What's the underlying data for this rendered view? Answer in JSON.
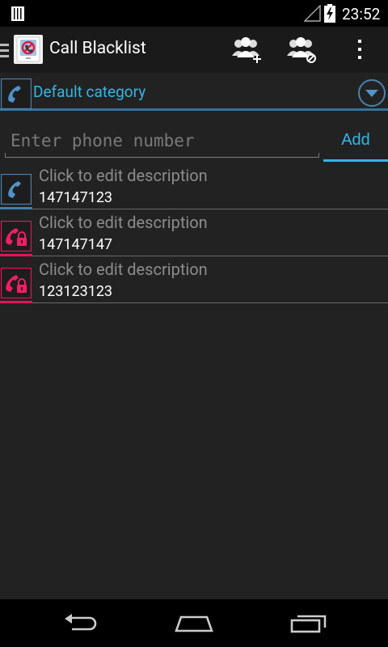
{
  "status_bar": {
    "time": "23:52",
    "icons": [
      "sim-card-icon",
      "signal-icon",
      "battery-charging-icon"
    ]
  },
  "action_bar": {
    "title": "Call Blacklist",
    "actions": [
      "add-contacts-icon",
      "block-contacts-icon",
      "overflow-menu-icon"
    ]
  },
  "category": {
    "label": "Default category",
    "icon": "phone-icon"
  },
  "input": {
    "placeholder": "Enter phone number",
    "value": ""
  },
  "add_button": {
    "label": "Add"
  },
  "colors": {
    "accent_blue": "#33b5e5",
    "blocked_pink": "#e0145a",
    "allowed_blue": "#3c7fb1"
  },
  "entries": [
    {
      "description": "Click to edit description",
      "number": "147147123",
      "status": "allowed"
    },
    {
      "description": "Click to edit description",
      "number": "147147147",
      "status": "blocked"
    },
    {
      "description": "Click to edit description",
      "number": "123123123",
      "status": "blocked"
    }
  ]
}
